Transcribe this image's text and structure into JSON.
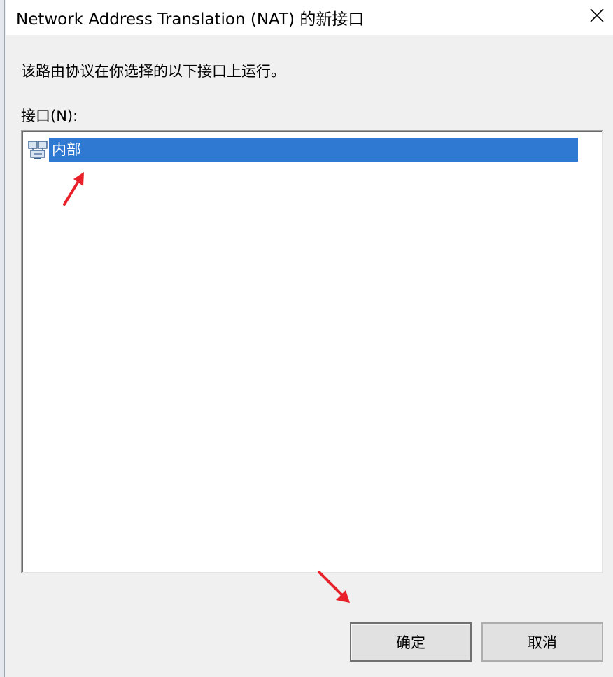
{
  "window": {
    "title": "Network Address Translation (NAT) 的新接口",
    "close_icon": "close-icon"
  },
  "description": "该路由协议在你选择的以下接口上运行。",
  "interfaces": {
    "label": "接口(N):",
    "items": [
      {
        "label": "内部",
        "icon": "network-interface-icon",
        "selected": true
      }
    ]
  },
  "buttons": {
    "ok_label": "确定",
    "cancel_label": "取消"
  },
  "annotations": {
    "arrow_color": "#e8202a"
  },
  "colors": {
    "selection": "#3079d3",
    "background": "#f0f0f0"
  }
}
